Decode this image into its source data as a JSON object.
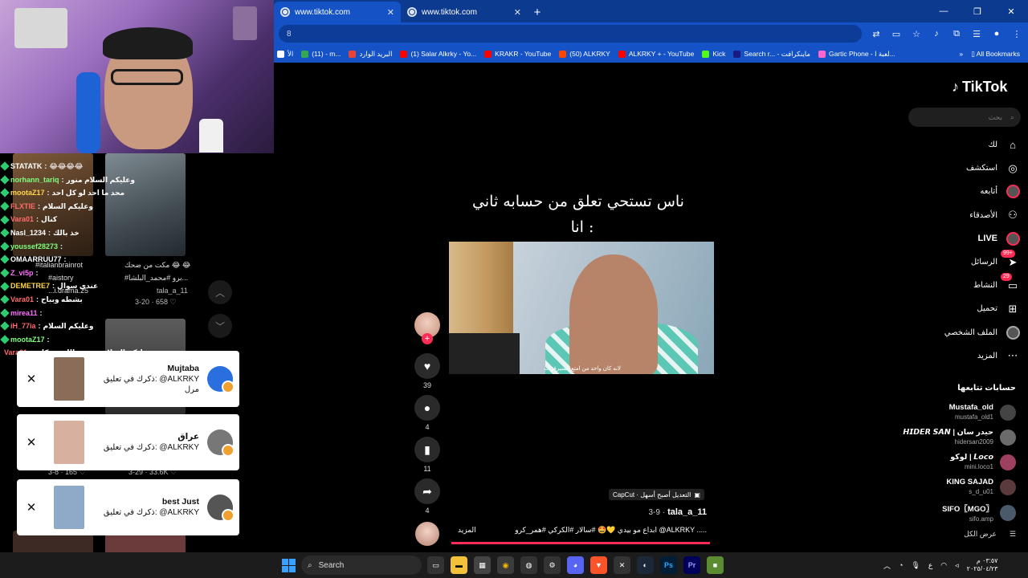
{
  "browser": {
    "tabs": [
      {
        "title": "www.tiktok.com",
        "active": true
      },
      {
        "title": "www.tiktok.com",
        "active": false
      }
    ],
    "omnibox": "8",
    "bookmarks": [
      {
        "label": "الأ",
        "color": "#ffffff"
      },
      {
        "label": "(11) - m...",
        "color": "#34a853"
      },
      {
        "label": "البريد الوارد",
        "color": "#ea4335"
      },
      {
        "label": "(1) Salar Alkrky - Yo...",
        "color": "#ff0000"
      },
      {
        "label": "KRAKR - YouTube",
        "color": "#ff0000"
      },
      {
        "label": "(50) ALKRKY",
        "color": "#ff4500"
      },
      {
        "label": "ALKRKY + - YouTube",
        "color": "#ff0000"
      },
      {
        "label": "Kick",
        "color": "#53fc18"
      },
      {
        "label": "Search r... - ماينكرافت",
        "color": "#1a1a80"
      },
      {
        "label": "Gartic Phone - لعبة ا...",
        "color": "#ff66cc"
      }
    ],
    "all_bookmarks": "All Bookmarks"
  },
  "chat": [
    {
      "user": "STATATK",
      "msg": "😂😂😂😂"
    },
    {
      "user": "norhann_tariq",
      "msg": "وعليكم السلام منور"
    },
    {
      "user": "mootaZ17",
      "msg": "محد ما احد لو كل احد"
    },
    {
      "user": "FLXTIE",
      "msg": "وعليكم السلام"
    },
    {
      "user": "Vara01",
      "msg": "كنال"
    },
    {
      "user": "Nasl_1234",
      "msg": "خذ بالك"
    },
    {
      "user": "youssef28273",
      "msg": ""
    },
    {
      "user": "OMAARRUU77",
      "msg": ""
    },
    {
      "user": "Z_vi5p",
      "msg": ""
    },
    {
      "user": "DEMETRE7",
      "msg": "عندي سوال"
    },
    {
      "user": "Vara01",
      "msg": "بشطه وبباح"
    },
    {
      "user": "mirea11",
      "msg": ""
    },
    {
      "user": "iH_77ia",
      "msg": "وعليكم السلام"
    },
    {
      "user": "mootaZ17",
      "msg": ""
    },
    {
      "user": "Vara01",
      "msg": "وعليكم السلام ورحمة الله وبركاته"
    }
  ],
  "grid": {
    "caption_a": "#italianbrainrot",
    "caption_a2": "#aistory",
    "caption_a3": "...i.drama.25",
    "caption_b": "مكت من ضحك 😂 😂",
    "caption_b2": "#برو #محمد_البلشا...",
    "author_b": "tala_a_11",
    "meta_b": "3-20 · 658 ♡",
    "meta_row2_a": "3-8 · 165 ♡",
    "meta_row2_b": "3-29 · 33.6K ♡"
  },
  "notifications": [
    {
      "name": "Mujtaba",
      "line1": "ذكرك في تعليق: @ALKRKY",
      "line2": "مرل",
      "thumb": "#8a6d58",
      "avatar": "#2a6fe0"
    },
    {
      "name": "عراق",
      "line1": "ذكرك في تعليق: @ALKRKY",
      "line2": "",
      "thumb": "#d7b0a0",
      "avatar": "#777777"
    },
    {
      "name": "best Just",
      "line1": "ذكرك في تعليق: @ALKRKY",
      "line2": "",
      "thumb": "#8fa9c8",
      "avatar": "#555555"
    }
  ],
  "video": {
    "caption_line1": "ناس تستحي تعلق من حسابه ثاني",
    "caption_line2": "انا :",
    "inner_subtitle": "لانه كان واحد من امتع السيرفرات",
    "capcut": "CapCut · التعديل أصبح أسهل",
    "author": "tala_a_11",
    "date": "3-9 ·",
    "description": "ابداع مو بيدي 💛🤩 #سالار #الكركي #همر_كرو @ALKRKY .....",
    "more": "المزيد",
    "progress": 1.0,
    "likes": "39",
    "comments": "4",
    "saves": "11",
    "shares": "4"
  },
  "tiktok": {
    "logo": "TikTok",
    "search_placeholder": "بحث",
    "nav": [
      {
        "label": "لك",
        "icon": "home-icon",
        "glyph": "⌂"
      },
      {
        "label": "استكشف",
        "icon": "compass-icon",
        "glyph": "◎"
      },
      {
        "label": "أتابعه",
        "icon": "following-avatar-icon",
        "glyph": ""
      },
      {
        "label": "الأصدقاء",
        "icon": "friends-icon",
        "glyph": "⚇"
      },
      {
        "label": "LIVE",
        "icon": "live-icon",
        "glyph": ""
      },
      {
        "label": "الرسائل",
        "icon": "messages-icon",
        "glyph": "➤",
        "badge": "99+"
      },
      {
        "label": "النشاط",
        "icon": "activity-icon",
        "glyph": "▭",
        "badge": "29"
      },
      {
        "label": "تحميل",
        "icon": "upload-icon",
        "glyph": "⊞"
      },
      {
        "label": "الملف الشخصي",
        "icon": "profile-avatar-icon",
        "glyph": ""
      },
      {
        "label": "المزيد",
        "icon": "more-icon",
        "glyph": "⋯"
      }
    ],
    "following_heading": "حسابات تتابعها",
    "accounts": [
      {
        "name": "Mustafa_old",
        "handle": "mustafa_old1",
        "color": "#444444"
      },
      {
        "name": "𝙃𝙄𝘿𝙀𝙍 𝙎𝘼𝙉 | حيدر سان",
        "handle": "hidersan2009",
        "color": "#6b6b6b"
      },
      {
        "name": "لوكو | 𝙇𝙤𝙘𝙤",
        "handle": "mini.loco1",
        "color": "#a04060"
      },
      {
        "name": "KING SAJAD",
        "handle": "s_d_u01",
        "color": "#5a3a3a"
      },
      {
        "name": "SIFO〖MGO〗",
        "handle": "sifo.amp",
        "color": "#4a5a6a"
      }
    ],
    "see_all": "عرض الكل"
  },
  "taskbar": {
    "search": "Search",
    "lang": "ع",
    "time": "٠٣:٥٧ م",
    "date": "٢٠٢٥/٠٤/٢٣"
  }
}
